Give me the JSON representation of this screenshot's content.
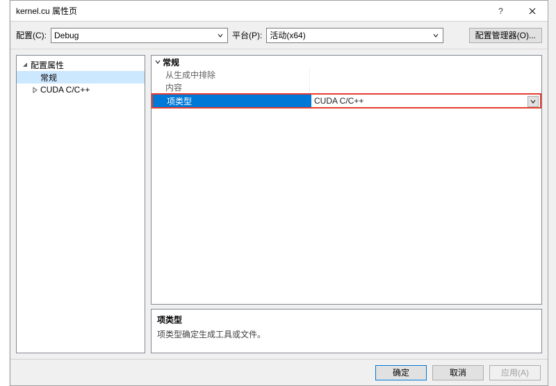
{
  "window": {
    "title": "kernel.cu 属性页"
  },
  "toolbar": {
    "config_label": "配置(C):",
    "config_value": "Debug",
    "platform_label": "平台(P):",
    "platform_value": "活动(x64)",
    "manager_button": "配置管理器(O)..."
  },
  "tree": {
    "root": "配置属性",
    "items": [
      "常规",
      "CUDA C/C++"
    ],
    "selected_index": 0
  },
  "properties": {
    "group_header": "常规",
    "rows": [
      {
        "name": "从生成中排除",
        "value": ""
      },
      {
        "name": "内容",
        "value": ""
      },
      {
        "name": "项类型",
        "value": "CUDA C/C++"
      }
    ],
    "highlighted_row_index": 2
  },
  "description": {
    "title": "项类型",
    "text": "项类型确定生成工具或文件。"
  },
  "buttons": {
    "ok": "确定",
    "cancel": "取消",
    "apply": "应用(A)"
  },
  "icons": {
    "expander_open": "▲",
    "expander_closed": "▷",
    "chevron_down": "▾",
    "help": "?",
    "close": "✕"
  }
}
